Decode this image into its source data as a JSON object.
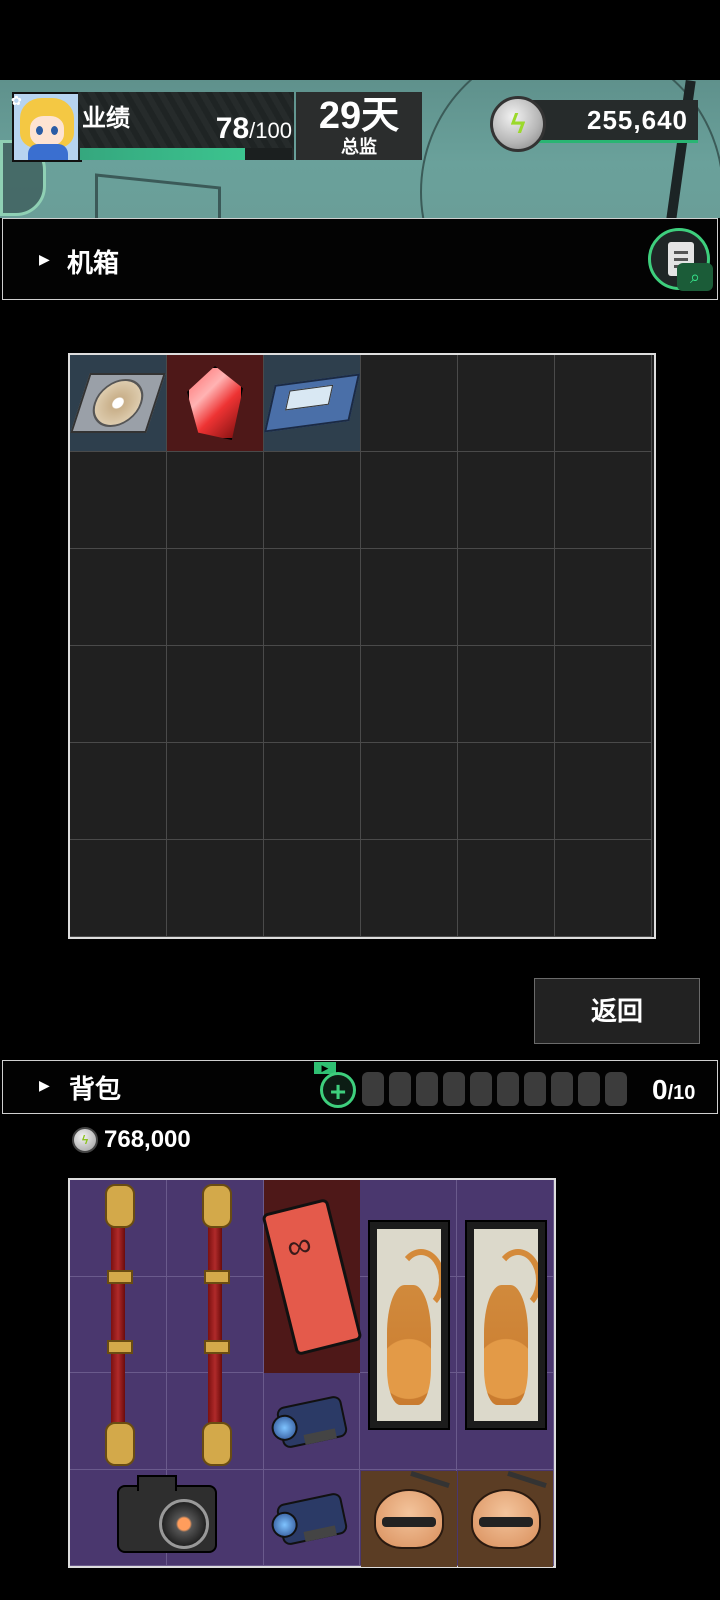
{
  "hud": {
    "performance_label": "业绩",
    "performance_current": "78",
    "performance_max": "/100",
    "performance_fraction": 0.78,
    "days_value": "29天",
    "days_label": "总监",
    "money": "255,640"
  },
  "chassis": {
    "title": "机箱",
    "items": [
      {
        "name": "cd-disc",
        "col": 1,
        "row": 1
      },
      {
        "name": "red-crystal",
        "col": 2,
        "row": 1
      },
      {
        "name": "cassette-tape",
        "col": 3,
        "row": 1
      }
    ],
    "return_label": "返回"
  },
  "bag": {
    "title": "背包",
    "count_current": "0",
    "count_max": "/10",
    "money": "768,000"
  },
  "colors": {
    "accent_green": "#3ecf7d",
    "bag_bg": "#4c3872",
    "chassis_bg": "#202020"
  }
}
